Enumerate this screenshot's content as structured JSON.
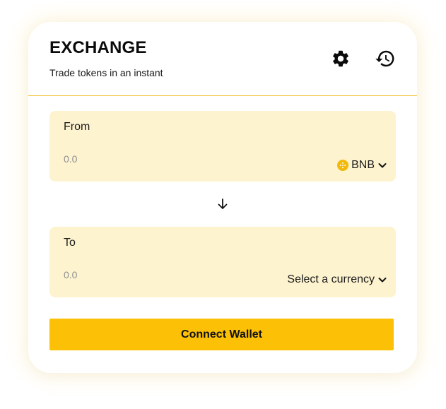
{
  "header": {
    "title": "EXCHANGE",
    "subtitle": "Trade tokens in an instant",
    "settings_icon": "gear-icon",
    "history_icon": "history-icon"
  },
  "from": {
    "label": "From",
    "amount_placeholder": "0.0",
    "currency": "BNB",
    "currency_icon": "bnb-token-icon"
  },
  "swap": {
    "icon": "arrow-down-icon"
  },
  "to": {
    "label": "To",
    "amount_placeholder": "0.0",
    "currency": "Select a currency"
  },
  "actions": {
    "connect_label": "Connect Wallet"
  },
  "colors": {
    "accent": "#fcc106",
    "panel_bg": "#fef3cf",
    "divider": "#f1c232",
    "bnb": "#f0b90b"
  }
}
